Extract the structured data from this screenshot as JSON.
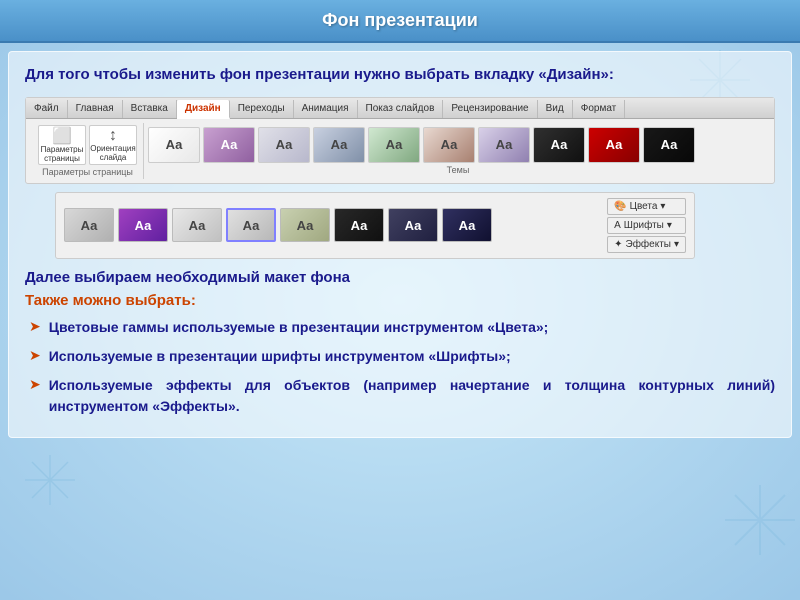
{
  "title": "Фон презентации",
  "intro": "Для того чтобы изменить фон презентации нужно выбрать вкладку «Дизайн»:",
  "ribbon": {
    "tabs": [
      "Файл",
      "Главная",
      "Вставка",
      "Дизайн",
      "Переходы",
      "Анимация",
      "Показ слайдов",
      "Рецензирование",
      "Вид",
      "Формат"
    ],
    "active_tab": "Дизайн",
    "group1_btn1": "Параметры страницы",
    "group1_btn2": "Ориентация слайда",
    "group1_label": "Параметры страницы",
    "themes_label": "Темы",
    "aa_label": "Аа"
  },
  "section1": "Далее выбираем необходимый макет фона",
  "section2": "Также можно выбрать:",
  "bullets": [
    "Цветовые гаммы используемые в презентации инструментом «Цвета»;",
    "Используемые в презентации шрифты инструментом «Шрифты»;",
    "Используемые эффекты для объектов (например начертание и толщина контурных линий) инструментом «Эффекты»."
  ],
  "side_tools": [
    "Цвета ▾",
    "Шрифты ▾",
    "Эффекты ▾"
  ],
  "colors_label": "Цвета",
  "fonts_label": "Шрифты",
  "effects_label": "Эффекты"
}
